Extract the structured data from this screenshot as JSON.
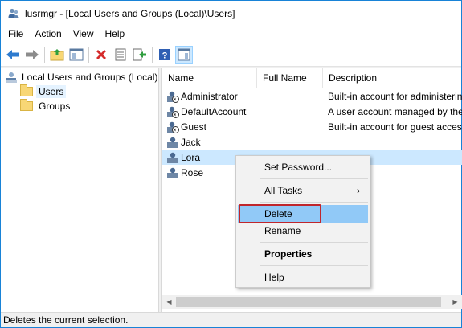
{
  "window": {
    "title": "lusrmgr - [Local Users and Groups (Local)\\Users]"
  },
  "menubar": {
    "items": [
      "File",
      "Action",
      "View",
      "Help"
    ]
  },
  "toolbar": {
    "buttons": [
      "back-arrow-icon",
      "forward-arrow-icon",
      "up-folder-icon",
      "show-hide-tree-icon",
      "delete-icon",
      "properties-icon",
      "export-list-icon",
      "help-icon",
      "show-hide-action-pane-icon"
    ]
  },
  "tree": {
    "root": "Local Users and Groups (Local)",
    "children": [
      "Users",
      "Groups"
    ],
    "selected": "Users"
  },
  "list": {
    "columns": [
      "Name",
      "Full Name",
      "Description"
    ],
    "rows": [
      {
        "name": "Administrator",
        "full_name": "",
        "description": "Built-in account for administering"
      },
      {
        "name": "DefaultAccount",
        "full_name": "",
        "description": "A user account managed by the"
      },
      {
        "name": "Guest",
        "full_name": "",
        "description": "Built-in account for guest acces"
      },
      {
        "name": "Jack",
        "full_name": "",
        "description": ""
      },
      {
        "name": "Lora",
        "full_name": "",
        "description": ""
      },
      {
        "name": "Rose",
        "full_name": "",
        "description": ""
      }
    ],
    "selected": "Lora"
  },
  "context_menu": {
    "items": [
      {
        "label": "Set Password...",
        "bold": false
      },
      {
        "label": "All Tasks",
        "bold": false,
        "submenu": true
      },
      {
        "label": "Delete",
        "bold": false,
        "hover": true
      },
      {
        "label": "Rename",
        "bold": false
      },
      {
        "label": "Properties",
        "bold": true
      },
      {
        "label": "Help",
        "bold": false
      }
    ],
    "submenu_arrow": "›"
  },
  "statusbar": {
    "text": "Deletes the current selection."
  },
  "colors": {
    "selection": "#cce8ff",
    "menu_hover": "#91c9f7",
    "highlight_box": "#c0262c",
    "window_border": "#1883d7"
  }
}
